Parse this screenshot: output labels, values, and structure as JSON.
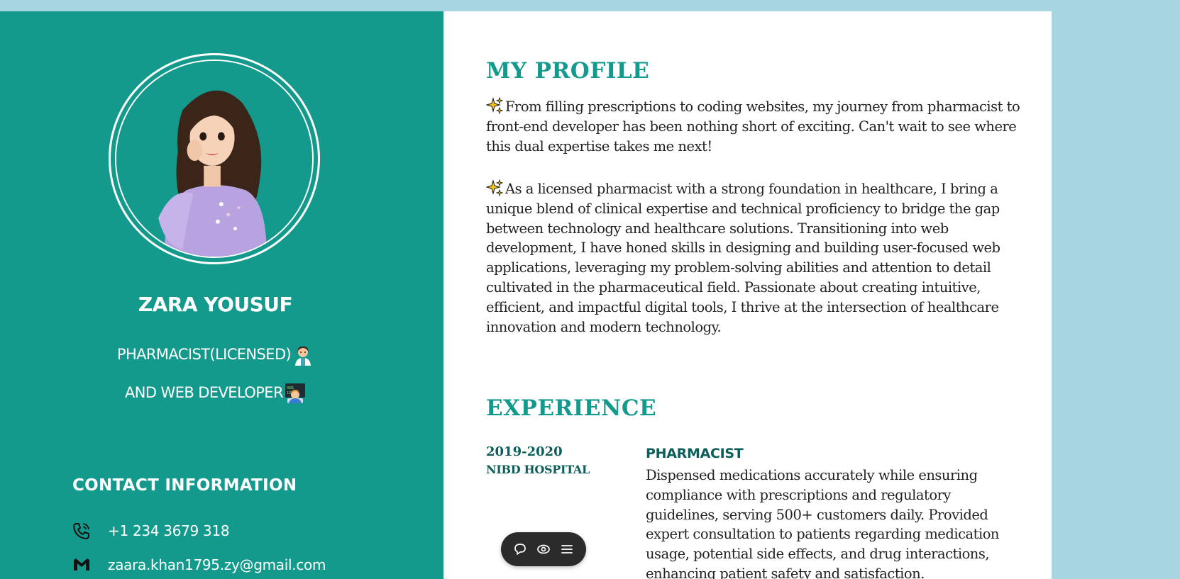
{
  "colors": {
    "background": "#a8d5e2",
    "sidebar": "#149a8d",
    "accent": "#149a8d",
    "dark_accent": "#0d5e5a",
    "text": "#222222",
    "toolbar": "#2b2b2b"
  },
  "sidebar": {
    "avatar_icon": "avatar-illustration",
    "name": "ZARA YOUSUF",
    "role_line_1": "PHARMACIST(LICENSED)",
    "role_line_1_emoji": "woman-health-worker-emoji",
    "role_line_2": "AND WEB DEVELOPER",
    "role_line_2_emoji": "technologist-emoji",
    "contact": {
      "heading": "CONTACT INFORMATION",
      "phone_icon": "phone-icon",
      "phone": "+1 234 3679 318",
      "email_icon": "gmail-icon",
      "email": "zaara.khan1795.zy@gmail.com"
    }
  },
  "main": {
    "profile": {
      "title": "MY PROFILE",
      "paragraph_icon": "sparkles-icon",
      "paragraph_1": "From filling prescriptions to coding websites, my journey from pharmacist to front-end developer has been nothing short of exciting. Can't wait to see where this dual expertise takes me next!",
      "paragraph_2": "As a licensed pharmacist with a strong foundation in healthcare, I bring a unique blend of clinical expertise and technical proficiency to bridge the gap between technology and healthcare solutions. Transitioning into web development, I have honed skills in designing and building user-focused web applications, leveraging my problem-solving abilities and attention to detail cultivated in the pharmaceutical field. Passionate about creating intuitive, efficient, and impactful digital tools, I thrive at the intersection of healthcare innovation and modern technology."
    },
    "experience": {
      "title": "EXPERIENCE",
      "items": [
        {
          "date": "2019-2020",
          "place": "NIBD HOSPITAL",
          "role": "PHARMACIST",
          "description": "Dispensed medications accurately while ensuring compliance with prescriptions and regulatory guidelines, serving 500+ customers daily. Provided expert consultation to patients regarding medication usage, potential side effects, and drug interactions, enhancing patient safety and satisfaction."
        }
      ]
    }
  },
  "toolbar": {
    "buttons": [
      "comment-icon",
      "eye-icon",
      "menu-icon"
    ]
  }
}
